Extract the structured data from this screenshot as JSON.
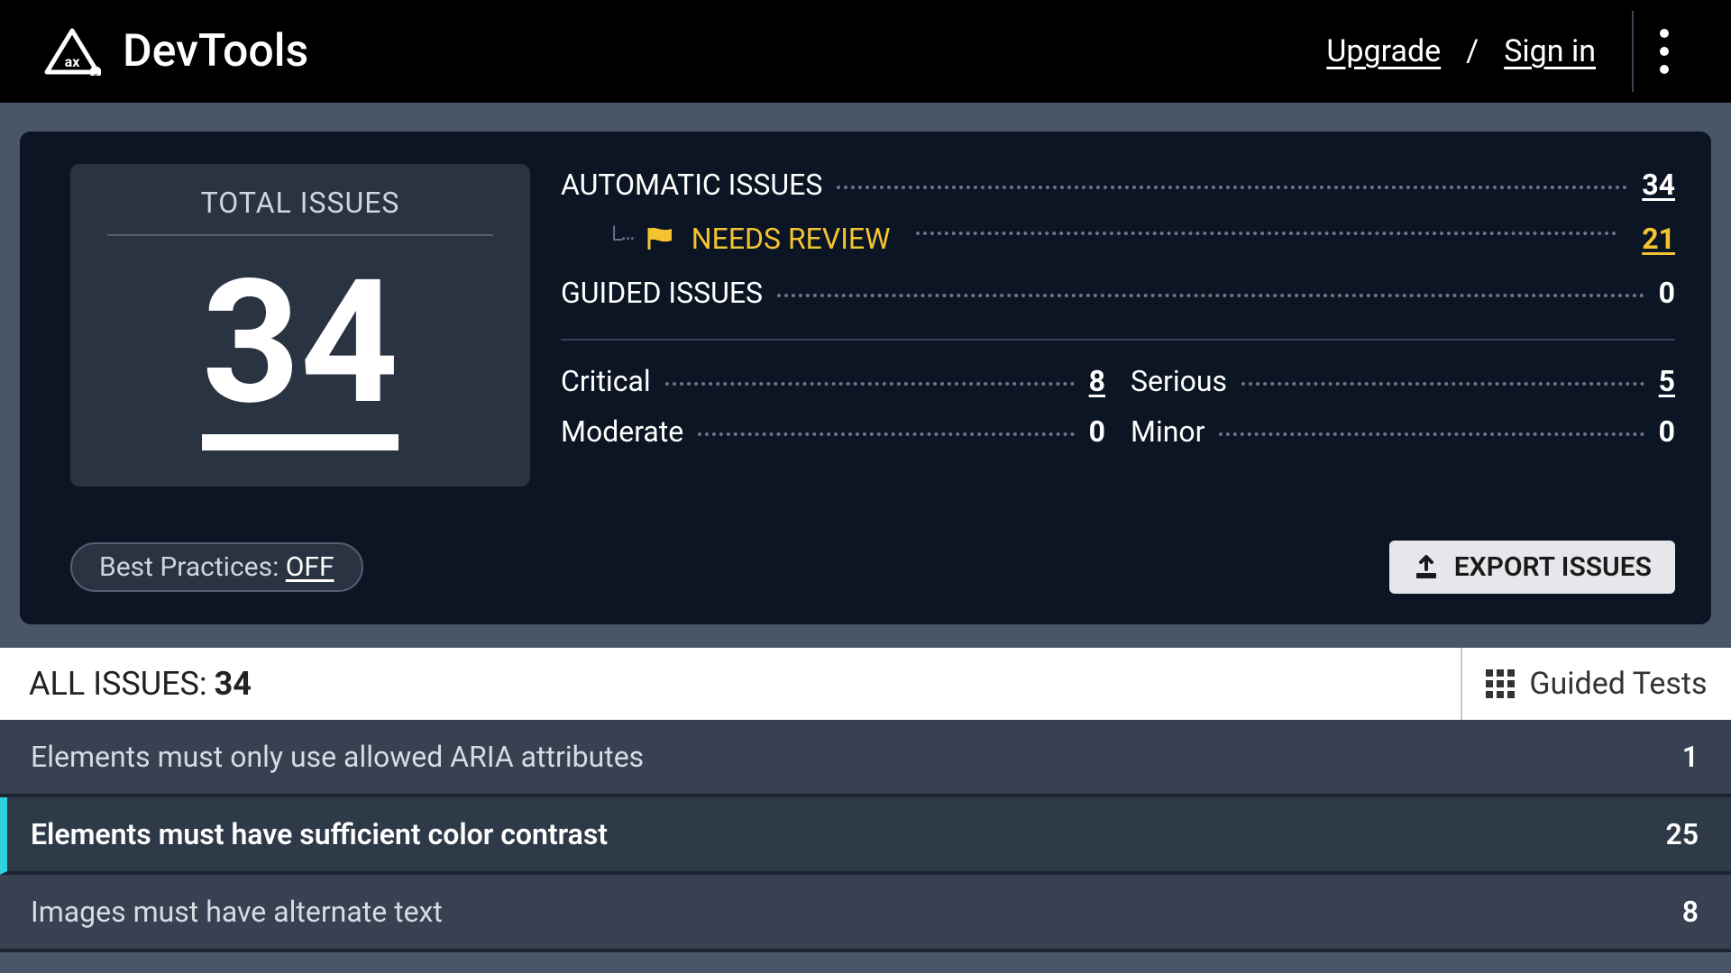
{
  "header": {
    "title": "DevTools",
    "upgrade": "Upgrade",
    "signin": "Sign in",
    "separator": "/"
  },
  "summary": {
    "total_label": "TOTAL ISSUES",
    "total_value": "34",
    "automatic": {
      "label": "AUTOMATIC ISSUES",
      "value": "34"
    },
    "needs_review": {
      "label": "NEEDS REVIEW",
      "value": "21"
    },
    "guided": {
      "label": "GUIDED ISSUES",
      "value": "0"
    },
    "severity": {
      "critical": {
        "label": "Critical",
        "value": "8"
      },
      "serious": {
        "label": "Serious",
        "value": "5"
      },
      "moderate": {
        "label": "Moderate",
        "value": "0"
      },
      "minor": {
        "label": "Minor",
        "value": "0"
      }
    }
  },
  "footer": {
    "best_practices_label": "Best Practices: ",
    "best_practices_state": "OFF",
    "export_label": "EXPORT ISSUES"
  },
  "allbar": {
    "prefix": "ALL ISSUES: ",
    "count": "34",
    "guided_tests": "Guided Tests"
  },
  "issues": [
    {
      "title": "Elements must only use allowed ARIA attributes",
      "count": "1",
      "active": false
    },
    {
      "title": "Elements must have sufficient color contrast",
      "count": "25",
      "active": true
    },
    {
      "title": "Images must have alternate text",
      "count": "8",
      "active": false
    }
  ]
}
